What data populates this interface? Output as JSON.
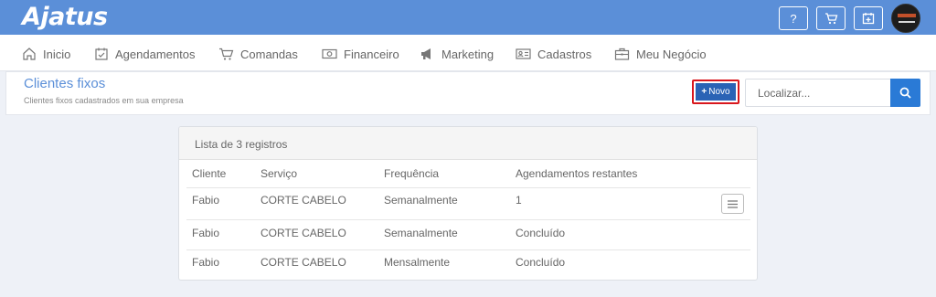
{
  "app": {
    "logo": "Ajatus"
  },
  "topbar": {
    "help_label": "?"
  },
  "nav": {
    "items": [
      {
        "label": "Inicio",
        "icon": "home-icon"
      },
      {
        "label": "Agendamentos",
        "icon": "calendar-check-icon"
      },
      {
        "label": "Comandas",
        "icon": "cart-icon"
      },
      {
        "label": "Financeiro",
        "icon": "money-icon"
      },
      {
        "label": "Marketing",
        "icon": "megaphone-icon"
      },
      {
        "label": "Cadastros",
        "icon": "id-card-icon"
      },
      {
        "label": "Meu Negócio",
        "icon": "briefcase-icon"
      }
    ]
  },
  "page": {
    "title": "Clientes fixos",
    "subtitle": "Clientes fixos cadastrados em sua empresa"
  },
  "toolbar": {
    "new_label": "Novo",
    "search_placeholder": "Localizar..."
  },
  "list": {
    "title": "Lista de 3 registros",
    "columns": [
      "Cliente",
      "Serviço",
      "Frequência",
      "Agendamentos restantes"
    ],
    "rows": [
      {
        "cliente": "Fabio",
        "servico": "CORTE CABELO",
        "frequencia": "Semanalmente",
        "restantes": "1"
      },
      {
        "cliente": "Fabio",
        "servico": "CORTE CABELO",
        "frequencia": "Semanalmente",
        "restantes": "Concluído"
      },
      {
        "cliente": "Fabio",
        "servico": "CORTE CABELO",
        "frequencia": "Mensalmente",
        "restantes": "Concluído"
      }
    ]
  },
  "colors": {
    "topbar": "#5b8fd8",
    "primary_button": "#2a63b5",
    "highlight_border": "#d8171d",
    "search_button": "#2a7ad6",
    "title": "#5b8fd8"
  }
}
